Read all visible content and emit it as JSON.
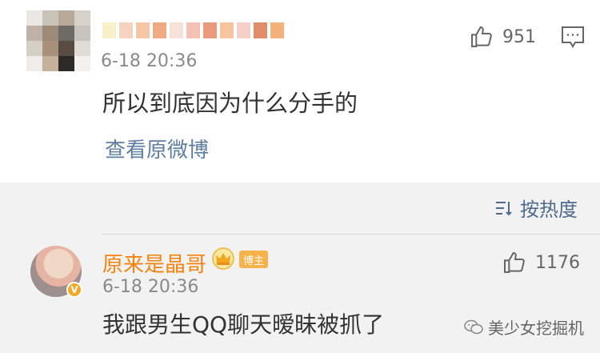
{
  "comment1": {
    "date": "6-18 20:36",
    "likes": "951",
    "content": "所以到底因为什么分手的",
    "view_post_link": "查看原微博",
    "avatar_blur_colors": [
      "#e9e6e3",
      "#c9c2b8",
      "#b7a89a",
      "#d7d1c9",
      "#bdb2a6",
      "#9d8a77",
      "#6e6a66",
      "#c7c2bd",
      "#d6cfc6",
      "#a8917b",
      "#5a4b43",
      "#e0dcd7",
      "#efede9",
      "#c4b09b",
      "#2b2a29",
      "#f3f1ee"
    ],
    "name_blur_colors": [
      "#f7f0c9",
      "#f5d3c0",
      "#f6c6a7",
      "#f0a982",
      "#f7e2d8",
      "#f5c1b7",
      "#e89a7a",
      "#f6c59c",
      "#f4d0c8",
      "#e28d6a",
      "#f3b27a"
    ]
  },
  "sort": {
    "label": "按热度"
  },
  "comment2": {
    "username": "原来是晶哥",
    "badge_label": "博主",
    "likes": "1176",
    "date": "6-18 20:36",
    "content": "我跟男生QQ聊天暧昧被抓了"
  },
  "watermark": {
    "text": "美少女挖掘机"
  },
  "colors": {
    "link": "#5f7ea3",
    "username": "#f4820c",
    "badge_bg": "#f7b24a",
    "section_bg": "#f2f2f2"
  }
}
